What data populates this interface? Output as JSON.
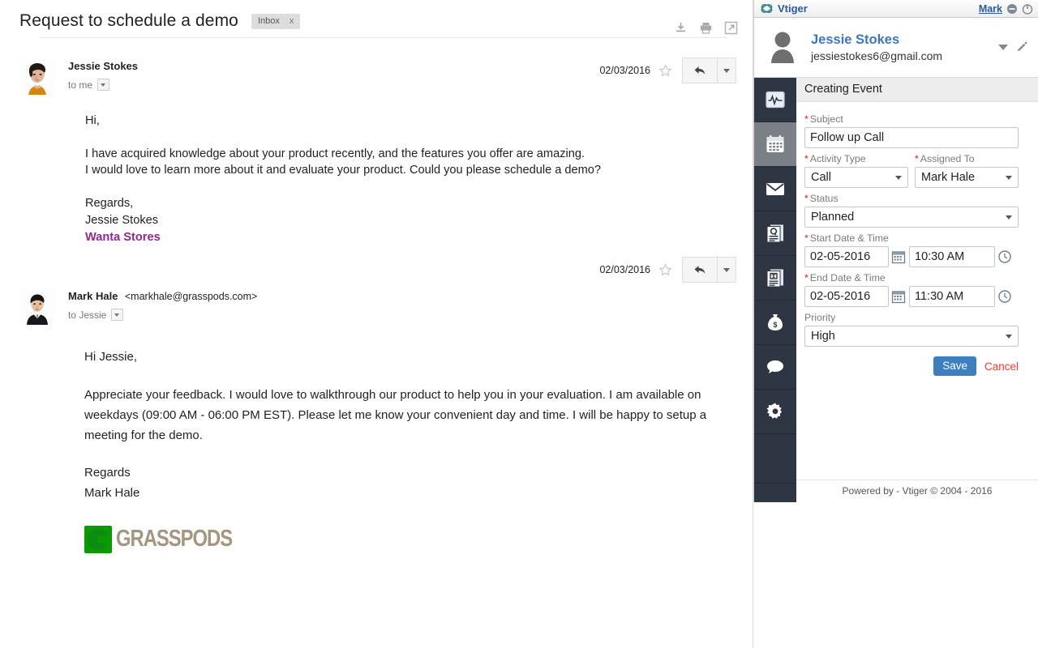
{
  "mail": {
    "subject": "Request to schedule a demo",
    "label": "Inbox",
    "label_close": "x",
    "toolbar": {
      "download": "download-icon",
      "print": "print-icon",
      "popout": "open-in-new-window-icon"
    },
    "messages": [
      {
        "sender": "Jessie Stokes",
        "sender_email": "",
        "recipient": "to me",
        "date": "02/03/2016",
        "greeting": "Hi,",
        "paragraph1": "I have acquired knowledge about your product recently, and the features you offer are amazing.",
        "paragraph2": "I would love to learn more about it and evaluate your product. Could you please schedule a demo?",
        "sign_off": "Regards,",
        "sign_name": "Jessie Stokes",
        "sign_company": "Wanta Stores",
        "company_color": "#93278f"
      },
      {
        "sender": "Mark Hale",
        "sender_email": "<markhale@grasspods.com>",
        "recipient": "to Jessie",
        "date": "02/03/2016",
        "greeting": "Hi Jessie,",
        "paragraph1": "Appreciate your feedback. I would love to walkthrough our product to help you in your evaluation. I am available on weekdays (09:00 AM - 06:00 PM EST). Please let me know your convenient day and time. I will be happy to setup a meeting for the demo.",
        "sign_off": "Regards",
        "sign_name": "Mark Hale",
        "logo_text": "GRASSPODS",
        "logo_color": "#0a9b00"
      }
    ]
  },
  "vtiger": {
    "titlebar": {
      "brand": "Vtiger",
      "user": "Mark",
      "minimize": "minimize-icon",
      "power": "power-icon"
    },
    "account": {
      "name": "Jessie Stokes",
      "email": "jessiestokes6@gmail.com"
    },
    "sidebar": [
      {
        "name": "activity-icon",
        "active": false
      },
      {
        "name": "calendar-icon",
        "active": true
      },
      {
        "name": "mail-icon",
        "active": false
      },
      {
        "name": "contacts-icon",
        "active": false
      },
      {
        "name": "documents-icon",
        "active": false
      },
      {
        "name": "money-bag-icon",
        "active": false
      },
      {
        "name": "comment-icon",
        "active": false
      },
      {
        "name": "gear-icon",
        "active": false
      }
    ],
    "form": {
      "section_title": "Creating Event",
      "subject_label": "Subject",
      "subject_value": "Follow up Call",
      "activity_type_label": "Activity Type",
      "activity_type_value": "Call",
      "assigned_to_label": "Assigned To",
      "assigned_to_value": "Mark Hale",
      "status_label": "Status",
      "status_value": "Planned",
      "start_label": "Start Date & Time",
      "start_date": "02-05-2016",
      "start_time": "10:30 AM",
      "end_label": "End Date & Time",
      "end_date": "02-05-2016",
      "end_time": "11:30 AM",
      "priority_label": "Priority",
      "priority_value": "High",
      "save_label": "Save",
      "cancel_label": "Cancel",
      "accent_color": "#3d7ebf",
      "required_color": "#e01b1b"
    },
    "footer": "Powered by - Vtiger © 2004 - 2016"
  }
}
